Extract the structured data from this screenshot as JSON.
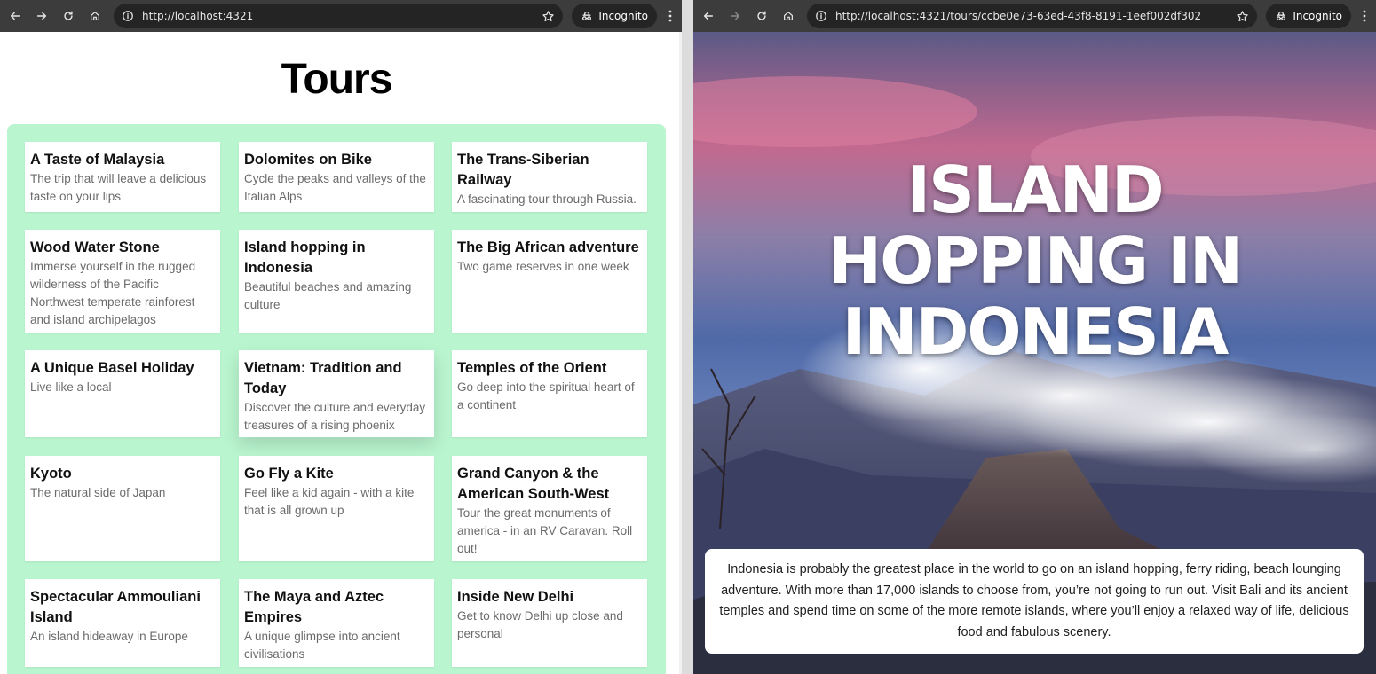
{
  "left_window": {
    "url": "http://localhost:4321",
    "incognito_label": "Incognito",
    "page_title": "Tours",
    "tours": [
      {
        "name": "A Taste of Malaysia",
        "description": "The trip that will leave a delicious taste on your lips"
      },
      {
        "name": "Dolomites on Bike",
        "description": "Cycle the peaks and valleys of the Italian Alps"
      },
      {
        "name": "The Trans-Siberian Railway",
        "description": "A fascinating tour through Russia."
      },
      {
        "name": "Wood Water Stone",
        "description": "Immerse yourself in the rugged wilderness of the Pacific Northwest temperate rainforest and island archipelagos"
      },
      {
        "name": "Island hopping in Indonesia",
        "description": "Beautiful beaches and amazing culture"
      },
      {
        "name": "The Big African adventure",
        "description": "Two game reserves in one week"
      },
      {
        "name": "A Unique Basel Holiday",
        "description": "Live like a local"
      },
      {
        "name": "Vietnam: Tradition and Today",
        "description": "Discover the culture and everyday treasures of a rising phoenix"
      },
      {
        "name": "Temples of the Orient",
        "description": "Go deep into the spiritual heart of a continent"
      },
      {
        "name": "Kyoto",
        "description": "The natural side of Japan"
      },
      {
        "name": "Go Fly a Kite",
        "description": "Feel like a kid again - with a kite that is all grown up"
      },
      {
        "name": "Grand Canyon & the American South-West",
        "description": "Tour the great monuments of america - in an RV Caravan. Roll out!"
      },
      {
        "name": "Spectacular Ammouliani Island",
        "description": "An island hideaway in Europe"
      },
      {
        "name": "The Maya and Aztec Empires",
        "description": "A unique glimpse into ancient civilisations"
      },
      {
        "name": "Inside New Delhi",
        "description": "Get to know Delhi up close and personal"
      }
    ]
  },
  "right_window": {
    "url": "http://localhost:4321/tours/ccbe0e73-63ed-43f8-8191-1eef002df302",
    "incognito_label": "Incognito",
    "hero_title_lines": [
      "ISLAND",
      "HOPPING IN",
      "INDONESIA"
    ],
    "description": "Indonesia is probably the greatest place in the world to go on an island hopping, ferry riding, beach lounging adventure. With more than 17,000 islands to choose from, you’re not going to run out. Visit Bali and its ancient temples and spend time on some of the more remote islands, where you’ll enjoy a relaxed way of life, delicious food and fabulous scenery."
  },
  "colors": {
    "browser_toolbar": "#3c3c3c",
    "omnibox": "#242424",
    "tours_panel": "#b9f5cf",
    "card": "#ffffff"
  },
  "icons": [
    "back-arrow-icon",
    "forward-arrow-icon",
    "reload-icon",
    "home-icon",
    "site-info-icon",
    "bookmark-star-icon",
    "incognito-icon",
    "kebab-menu-icon"
  ]
}
